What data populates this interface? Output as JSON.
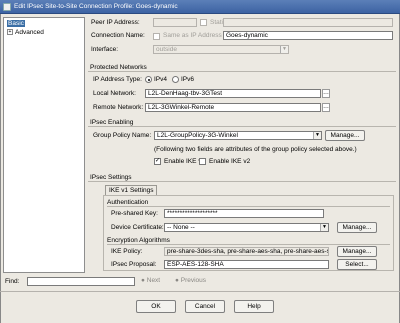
{
  "window": {
    "title": "Edit IPsec Site-to-Site Connection Profile: Goes-dynamic"
  },
  "tree": {
    "items": [
      {
        "label": "Basic"
      },
      {
        "label": "Advanced"
      }
    ]
  },
  "form": {
    "peer_ip": {
      "label": "Peer IP Address:",
      "static_label": "Static",
      "value": ""
    },
    "connection_name": {
      "label": "Connection Name:",
      "same_as_ip_label": "Same as IP Address",
      "value": "Goes-dynamic"
    },
    "interface": {
      "label": "Interface:",
      "value": "outside"
    },
    "protected_networks": {
      "title": "Protected Networks",
      "ip_type_label": "IP Address Type:",
      "ipv4": "IPv4",
      "ipv6": "IPv6",
      "local_label": "Local Network:",
      "local_value": "L2L-DenHaag-tbv-3GTest",
      "remote_label": "Remote Network:",
      "remote_value": "L2L-3GWinkel-Remote"
    },
    "ipsec_enabling": {
      "title": "IPsec Enabling",
      "group_policy_label": "Group Policy Name:",
      "group_policy_value": "L2L-GroupPolicy-3G-Winkel",
      "manage_label": "Manage...",
      "note": "(Following two fields are attributes of the group policy selected above.)",
      "ikev1_label": "Enable IKE v1",
      "ikev2_label": "Enable IKE v2"
    },
    "ipsec_settings": {
      "title": "IPsec Settings",
      "tab_label": "IKE v1 Settings",
      "auth_title": "Authentication",
      "psk_label": "Pre-shared Key:",
      "psk_value": "********************",
      "cert_label": "Device Certificate:",
      "cert_value": "-- None --",
      "cert_manage_label": "Manage...",
      "enc_title": "Encryption Algorithms",
      "ike_policy_label": "IKE Policy:",
      "ike_policy_value": "pre-share-3des-sha, pre-share-aes-sha, pre-share-aes-sha, pre-share-a",
      "ike_manage_label": "Manage...",
      "proposal_label": "IPsec Proposal:",
      "proposal_value": "ESP-AES-128-SHA",
      "select_label": "Select..."
    }
  },
  "find": {
    "label": "Find:",
    "value": "",
    "next_label": "Next",
    "previous_label": "Previous"
  },
  "buttons": {
    "ok": "OK",
    "cancel": "Cancel",
    "help": "Help"
  }
}
